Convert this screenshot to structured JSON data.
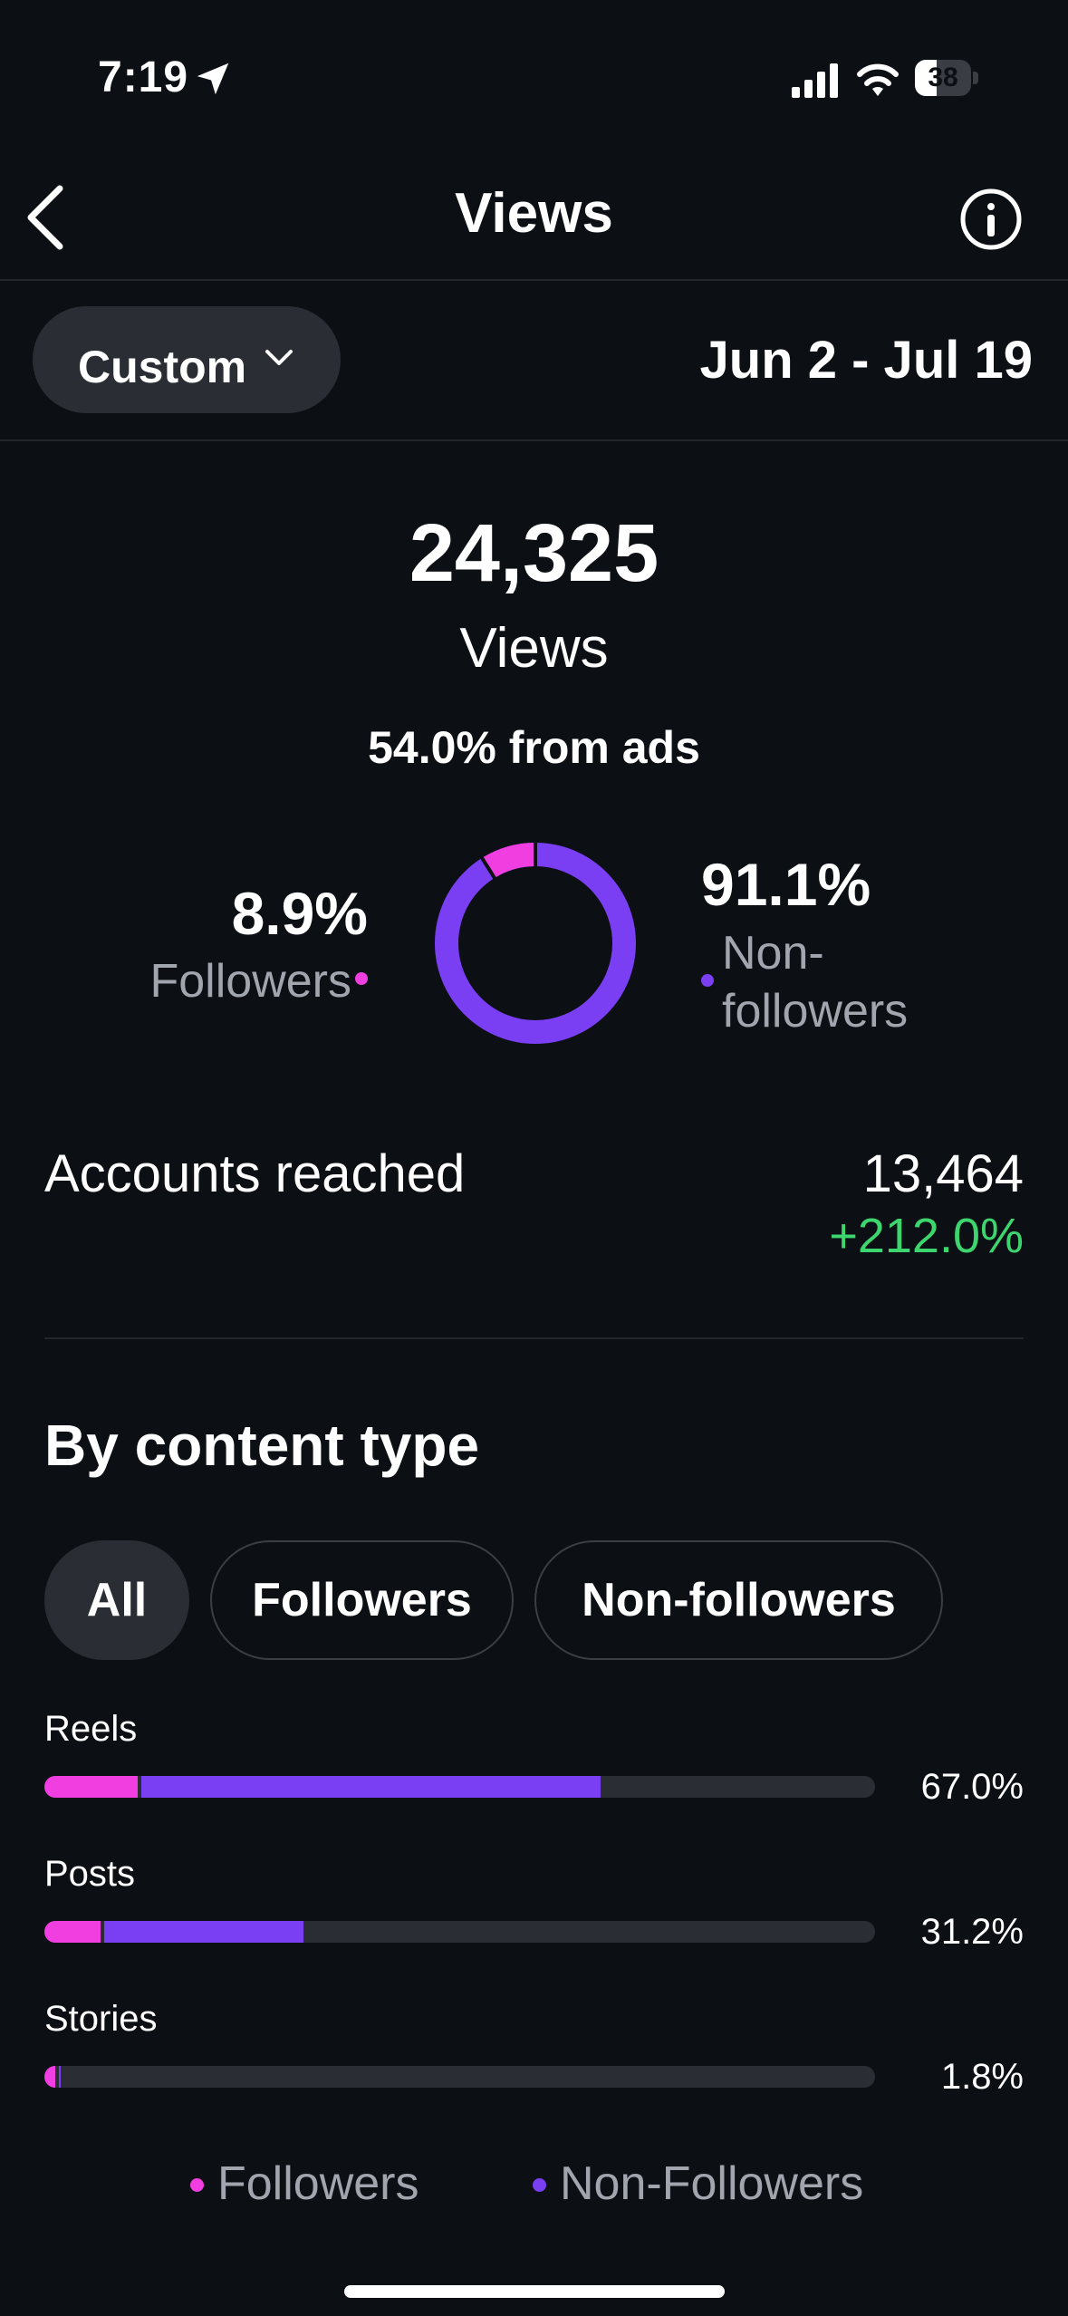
{
  "status_bar": {
    "time": "7:19",
    "battery": "38",
    "battery_level": 0.38
  },
  "header": {
    "title": "Views",
    "back_icon": "chevron-left-icon",
    "info_icon": "info-circle-icon"
  },
  "range": {
    "selector_label": "Custom",
    "dates": "Jun 2 - Jul 19"
  },
  "summary": {
    "views_count": "24,325",
    "views_label": "Views",
    "ads_text": "54.0% from ads",
    "followers_pct": "8.9%",
    "followers_label": "Followers",
    "nonfollowers_pct": "91.1%",
    "nonfollowers_label": "Non-\nfollowers",
    "followers_share": 0.089
  },
  "accounts": {
    "label": "Accounts reached",
    "value": "13,464",
    "change": "+212.0%"
  },
  "content_type": {
    "title": "By content type",
    "filters": [
      "All",
      "Followers",
      "Non-followers"
    ],
    "active_filter": "All",
    "rows": [
      {
        "label": "Reels",
        "pct": "67.0%",
        "total": 67.0,
        "followers_portion": 11.2
      },
      {
        "label": "Posts",
        "pct": "31.2%",
        "total": 31.2,
        "followers_portion": 6.8
      },
      {
        "label": "Stories",
        "pct": "1.8%",
        "total": 1.8,
        "followers_portion": 1.3
      }
    ],
    "legend": {
      "followers": "Followers",
      "nonfollowers": "Non-Followers"
    }
  },
  "colors": {
    "followers": "#f03ee0",
    "nonfollowers": "#7a3ff2",
    "positive": "#3dd56d",
    "background": "#0c0f14"
  }
}
